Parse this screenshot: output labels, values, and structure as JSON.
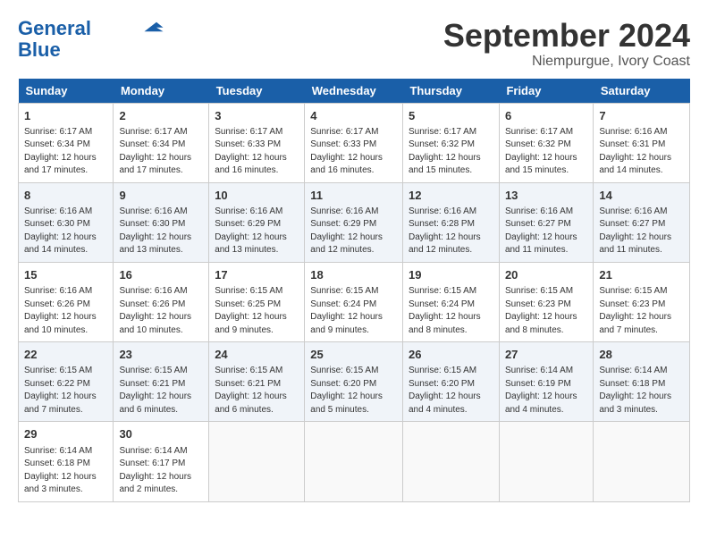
{
  "header": {
    "logo_line1": "General",
    "logo_line2": "Blue",
    "month": "September 2024",
    "location": "Niempurgue, Ivory Coast"
  },
  "weekdays": [
    "Sunday",
    "Monday",
    "Tuesday",
    "Wednesday",
    "Thursday",
    "Friday",
    "Saturday"
  ],
  "weeks": [
    [
      {
        "day": "1",
        "sunrise": "6:17 AM",
        "sunset": "6:34 PM",
        "daylight": "12 hours and 17 minutes."
      },
      {
        "day": "2",
        "sunrise": "6:17 AM",
        "sunset": "6:34 PM",
        "daylight": "12 hours and 17 minutes."
      },
      {
        "day": "3",
        "sunrise": "6:17 AM",
        "sunset": "6:33 PM",
        "daylight": "12 hours and 16 minutes."
      },
      {
        "day": "4",
        "sunrise": "6:17 AM",
        "sunset": "6:33 PM",
        "daylight": "12 hours and 16 minutes."
      },
      {
        "day": "5",
        "sunrise": "6:17 AM",
        "sunset": "6:32 PM",
        "daylight": "12 hours and 15 minutes."
      },
      {
        "day": "6",
        "sunrise": "6:17 AM",
        "sunset": "6:32 PM",
        "daylight": "12 hours and 15 minutes."
      },
      {
        "day": "7",
        "sunrise": "6:16 AM",
        "sunset": "6:31 PM",
        "daylight": "12 hours and 14 minutes."
      }
    ],
    [
      {
        "day": "8",
        "sunrise": "6:16 AM",
        "sunset": "6:30 PM",
        "daylight": "12 hours and 14 minutes."
      },
      {
        "day": "9",
        "sunrise": "6:16 AM",
        "sunset": "6:30 PM",
        "daylight": "12 hours and 13 minutes."
      },
      {
        "day": "10",
        "sunrise": "6:16 AM",
        "sunset": "6:29 PM",
        "daylight": "12 hours and 13 minutes."
      },
      {
        "day": "11",
        "sunrise": "6:16 AM",
        "sunset": "6:29 PM",
        "daylight": "12 hours and 12 minutes."
      },
      {
        "day": "12",
        "sunrise": "6:16 AM",
        "sunset": "6:28 PM",
        "daylight": "12 hours and 12 minutes."
      },
      {
        "day": "13",
        "sunrise": "6:16 AM",
        "sunset": "6:27 PM",
        "daylight": "12 hours and 11 minutes."
      },
      {
        "day": "14",
        "sunrise": "6:16 AM",
        "sunset": "6:27 PM",
        "daylight": "12 hours and 11 minutes."
      }
    ],
    [
      {
        "day": "15",
        "sunrise": "6:16 AM",
        "sunset": "6:26 PM",
        "daylight": "12 hours and 10 minutes."
      },
      {
        "day": "16",
        "sunrise": "6:16 AM",
        "sunset": "6:26 PM",
        "daylight": "12 hours and 10 minutes."
      },
      {
        "day": "17",
        "sunrise": "6:15 AM",
        "sunset": "6:25 PM",
        "daylight": "12 hours and 9 minutes."
      },
      {
        "day": "18",
        "sunrise": "6:15 AM",
        "sunset": "6:24 PM",
        "daylight": "12 hours and 9 minutes."
      },
      {
        "day": "19",
        "sunrise": "6:15 AM",
        "sunset": "6:24 PM",
        "daylight": "12 hours and 8 minutes."
      },
      {
        "day": "20",
        "sunrise": "6:15 AM",
        "sunset": "6:23 PM",
        "daylight": "12 hours and 8 minutes."
      },
      {
        "day": "21",
        "sunrise": "6:15 AM",
        "sunset": "6:23 PM",
        "daylight": "12 hours and 7 minutes."
      }
    ],
    [
      {
        "day": "22",
        "sunrise": "6:15 AM",
        "sunset": "6:22 PM",
        "daylight": "12 hours and 7 minutes."
      },
      {
        "day": "23",
        "sunrise": "6:15 AM",
        "sunset": "6:21 PM",
        "daylight": "12 hours and 6 minutes."
      },
      {
        "day": "24",
        "sunrise": "6:15 AM",
        "sunset": "6:21 PM",
        "daylight": "12 hours and 6 minutes."
      },
      {
        "day": "25",
        "sunrise": "6:15 AM",
        "sunset": "6:20 PM",
        "daylight": "12 hours and 5 minutes."
      },
      {
        "day": "26",
        "sunrise": "6:15 AM",
        "sunset": "6:20 PM",
        "daylight": "12 hours and 4 minutes."
      },
      {
        "day": "27",
        "sunrise": "6:14 AM",
        "sunset": "6:19 PM",
        "daylight": "12 hours and 4 minutes."
      },
      {
        "day": "28",
        "sunrise": "6:14 AM",
        "sunset": "6:18 PM",
        "daylight": "12 hours and 3 minutes."
      }
    ],
    [
      {
        "day": "29",
        "sunrise": "6:14 AM",
        "sunset": "6:18 PM",
        "daylight": "12 hours and 3 minutes."
      },
      {
        "day": "30",
        "sunrise": "6:14 AM",
        "sunset": "6:17 PM",
        "daylight": "12 hours and 2 minutes."
      },
      null,
      null,
      null,
      null,
      null
    ]
  ]
}
